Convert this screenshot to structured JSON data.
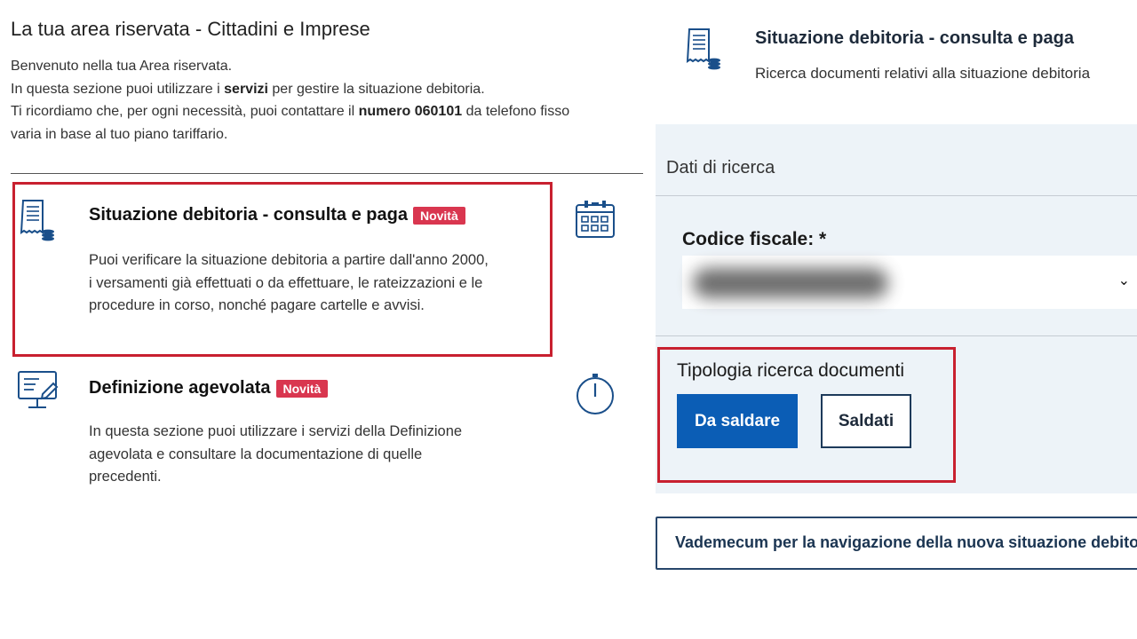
{
  "left": {
    "area_title": "La tua area riservata - Cittadini e Imprese",
    "intro": {
      "line1": "Benvenuto nella tua Area riservata.",
      "line2_pre": "In questa sezione puoi utilizzare i ",
      "line2_bold": "servizi",
      "line2_post": " per gestire la situazione debitoria.",
      "line3_pre": "Ti ricordiamo che, per ogni necessità, puoi contattare il ",
      "line3_bold": "numero 060101",
      "line3_post": " da telefono fisso",
      "line4": "varia in base al tuo piano tariffario."
    },
    "cards": [
      {
        "title": "Situazione debitoria - consulta e paga",
        "badge": "Novità",
        "desc1": "Puoi verificare la situazione debitoria a partire dall'anno 2000,",
        "desc2": "i versamenti già effettuati o da effettuare, le rateizzazioni e le",
        "desc3": "procedure in corso, nonché pagare cartelle e avvisi.",
        "icon": "receipt-icon",
        "side_icon": "calendar-icon"
      },
      {
        "title": "Definizione agevolata",
        "badge": "Novità",
        "desc1": "In questa sezione puoi utilizzare i servizi della Definizione",
        "desc2": "agevolata e consultare la documentazione di quelle",
        "desc3": "precedenti.",
        "icon": "monitor-edit-icon",
        "side_icon": "timer-icon"
      }
    ]
  },
  "right": {
    "header_title": "Situazione debitoria - consulta e paga",
    "header_subtitle": "Ricerca documenti relativi alla situazione debitoria",
    "panel_title": "Dati di ricerca",
    "codice_fiscale_label": "Codice fiscale: *",
    "tipologia_label": "Tipologia ricerca documenti",
    "btn_da_saldare": "Da saldare",
    "btn_saldati": "Saldati",
    "vademecum": "Vademecum per la navigazione della nuova situazione debitoria"
  },
  "colors": {
    "badge": "#d9364f",
    "highlight": "#c8202f",
    "primary": "#0b5db5",
    "panel_bg": "#edf3f8",
    "icon_blue": "#1a4f8a"
  }
}
